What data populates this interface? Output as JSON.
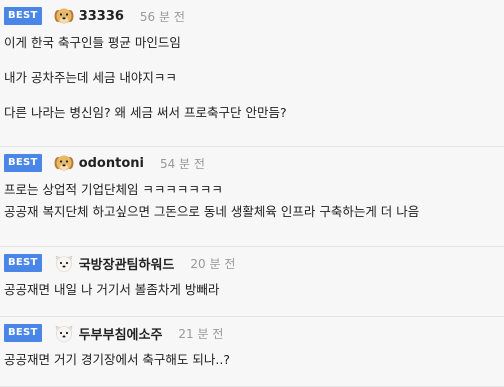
{
  "comments": [
    {
      "badge": "BEST",
      "avatar_icon": "dog-icon",
      "username": "33336",
      "time": "56 분 전",
      "lines": [
        "이게 한국 축구인들 평균 마인드임",
        "내가 공차주는데 세금 내야지ㅋㅋ",
        "다른 나라는 병신임? 왜 세금 써서 프로축구단 안만듬?"
      ]
    },
    {
      "badge": "BEST",
      "avatar_icon": "dog-icon",
      "username": "odontoni",
      "time": "54 분 전",
      "lines": [
        "프로는 상업적 기업단체임 ㅋㅋㅋㅋㅋㅋㅋ",
        "공공재 복지단체 하고싶으면 그돈으로 동네 생활체육 인프라 구축하는게 더 나음"
      ]
    },
    {
      "badge": "BEST",
      "avatar_icon": "white-dog-icon",
      "username": "국방장관팀하워드",
      "time": "20 분 전",
      "lines": [
        "공공재면 내일 나 거기서 볼좀차게 방빼라"
      ]
    },
    {
      "badge": "BEST",
      "avatar_icon": "white-dog-icon",
      "username": "두부부침에소주",
      "time": "21 분 전",
      "lines": [
        "공공재면 거기 경기장에서 축구해도 되나..?"
      ]
    }
  ]
}
